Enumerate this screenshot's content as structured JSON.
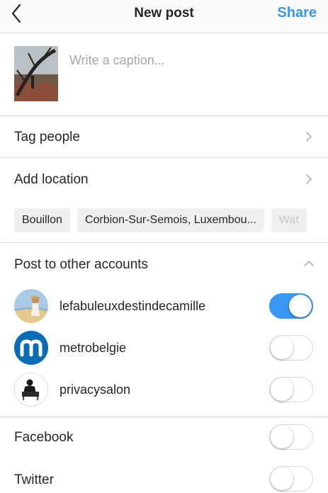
{
  "header": {
    "title": "New post",
    "share_label": "Share",
    "back_icon": "chevron-left-icon"
  },
  "caption": {
    "placeholder": "Write a caption...",
    "value": ""
  },
  "rows": {
    "tag_people": "Tag people",
    "add_location": "Add location"
  },
  "location_suggestions": [
    "Bouillon",
    "Corbion-Sur-Semois, Luxembou...",
    "Wat"
  ],
  "post_to_other": {
    "title": "Post to other accounts",
    "accounts": [
      {
        "name": "lefabuleuxdestindecamille",
        "enabled": true
      },
      {
        "name": "metrobelgie",
        "enabled": false
      },
      {
        "name": "privacysalon",
        "enabled": false
      }
    ]
  },
  "networks": [
    {
      "name": "Facebook",
      "enabled": false
    },
    {
      "name": "Twitter",
      "enabled": false
    }
  ],
  "colors": {
    "accent": "#3897f0",
    "divider": "#dbdbdb",
    "chip_bg": "#efefef",
    "metro_blue": "#0a6cb4"
  }
}
